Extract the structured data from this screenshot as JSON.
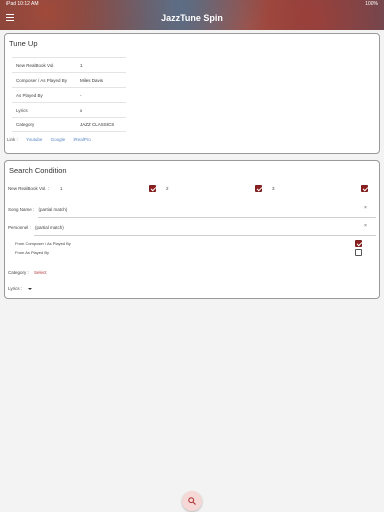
{
  "statusbar": {
    "left": "iPad 10:12 AM",
    "right": "100%"
  },
  "header": {
    "title": "JazzTune Spin"
  },
  "tune_up": {
    "title": "Tune Up",
    "rows": [
      {
        "label": "New RealBook Vol.",
        "value": "1"
      },
      {
        "label": "Composer / As Played By",
        "value": "Miles Davis"
      },
      {
        "label": "As Played By",
        "value": "-"
      },
      {
        "label": "Lyrics",
        "value": "x"
      },
      {
        "label": "Category",
        "value": "JAZZ CLASSICS"
      }
    ],
    "links_label": "Link :",
    "links": [
      "Youtube",
      "Google",
      "iRealPro"
    ]
  },
  "search": {
    "title": "Search Condition",
    "vol_label": "New RealBook Vol. :",
    "vol_options": [
      "1",
      "2",
      "3"
    ],
    "song_label": "Song Name :",
    "song_placeholder": "(partial match)",
    "personnel_label": "Personnel :",
    "personnel_placeholder": "(partial match)",
    "from_composer": "From Composer / As Played By",
    "from_played": "From As Played By",
    "category_label": "Category :",
    "category_select": "Select",
    "lyrics_label": "Lyrics :",
    "clear": "×"
  },
  "colors": {
    "accent": "#8c1e1e",
    "link": "#5b87c4"
  }
}
